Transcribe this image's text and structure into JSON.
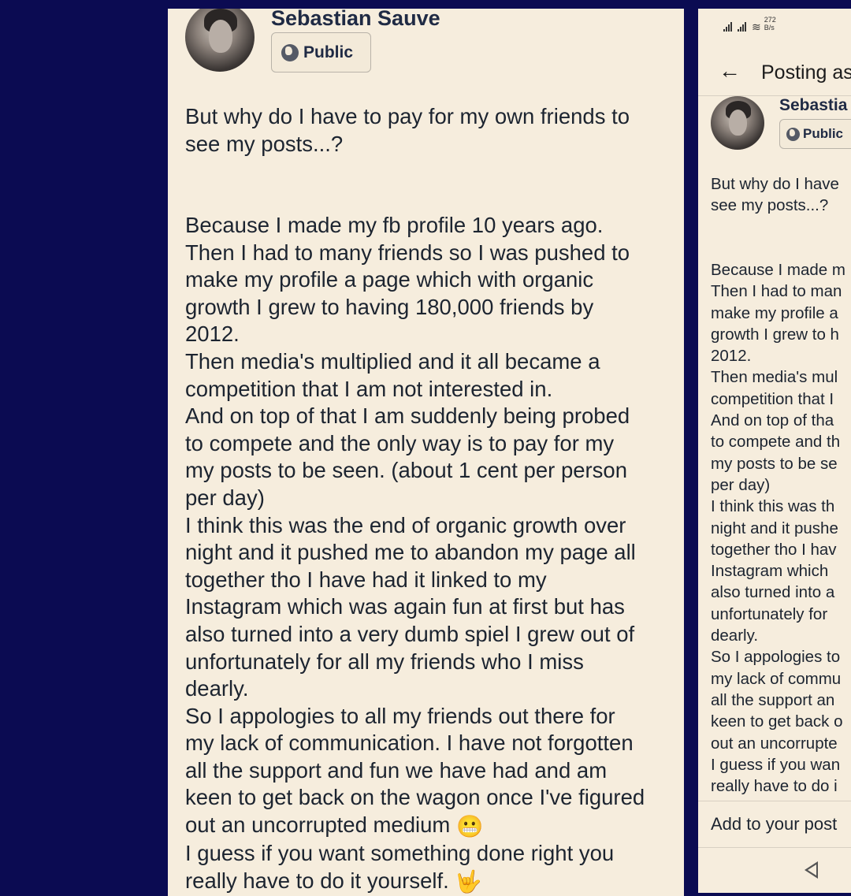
{
  "post": {
    "author": "Sebastian Sauve",
    "privacy": "Public",
    "paragraphs": [
      "But why do I have to pay for my own friends to see my posts...?",
      "Because I made my fb profile 10 years ago. Then I had to many friends so I was pushed to make my profile a page which with organic growth I grew to having 180,000 friends by 2012. Then media's multiplied and it all became a competition that I am not interested in. And on top of that I am suddenly being probed to compete and the only way is to pay for my my posts to be seen. (about 1 cent per person per day) I think this was the end of organic growth over night and it pushed me to abandon my page all together tho I have had it linked to my Instagram which was again fun at first but has also turned into a very dumb spiel I grew out of unfortunately for all my friends who I miss dearly. So I appologies to all my friends out there for my lack of communication. I have not forgotten all the support and fun we have had and am keen to get back on the wagon once I've figured out an uncorrupted medium 😬 I guess if you want something done right you really have to do it yourself. 🤟"
    ],
    "left_lines": {
      "p1": "But why do I have to pay for my own friends to\nsee my posts...?",
      "p2": "Because I made my fb profile 10 years ago.\nThen I had to many friends so I was pushed to\nmake my profile a page which with organic\ngrowth I grew to having 180,000 friends by\n2012.\nThen media's multiplied and it all became a\ncompetition that I am not interested in.\nAnd on top of that I am suddenly being probed\nto compete and the only way is to pay for my\nmy posts to be seen. (about 1 cent per person\nper day)\nI think this was the end of organic growth over\nnight and it pushed me to abandon my page all\ntogether tho I have had it linked to my\nInstagram which was again fun at first but has\nalso turned into a very dumb spiel I grew out of\nunfortunately for all my friends who I miss\ndearly.\nSo I appologies to all my friends out there for\nmy lack of communication. I have not forgotten\nall the support and fun we have had and am\nkeen to get back on the wagon once I've figured\nout an uncorrupted medium ",
      "p2_end": "I guess if you want something done right you\nreally have to do it yourself. ",
      "emoji_grimace": "😬",
      "emoji_horns": "🤟"
    },
    "right_lines": {
      "p1": "But why do I have\nsee my posts...?",
      "p2": "Because I made m\nThen I had to man\nmake my profile a\ngrowth I grew to h\n2012.\nThen media's mul\ncompetition that I\nAnd on top of tha\nto compete and th\nmy posts to be se\nper day)\nI think this was th\nnight and it pushe\ntogether tho I hav\nInstagram which \nalso turned into a\nunfortunately for \ndearly.\nSo I appologies to\nmy lack of commu\nall the support an\nkeen to get back o\nout an uncorrupte\nI guess if you wan\nreally have to do i"
    }
  },
  "composer": {
    "status_speed_value": "272",
    "status_speed_unit": "B/s",
    "title": "Posting as",
    "author_short": "Sebastia",
    "privacy": "Public",
    "add_to_post": "Add to your post"
  },
  "colors": {
    "background": "#0b0b52",
    "panel": "#f6eddd",
    "text": "#1c2430",
    "name": "#1f2a44"
  }
}
